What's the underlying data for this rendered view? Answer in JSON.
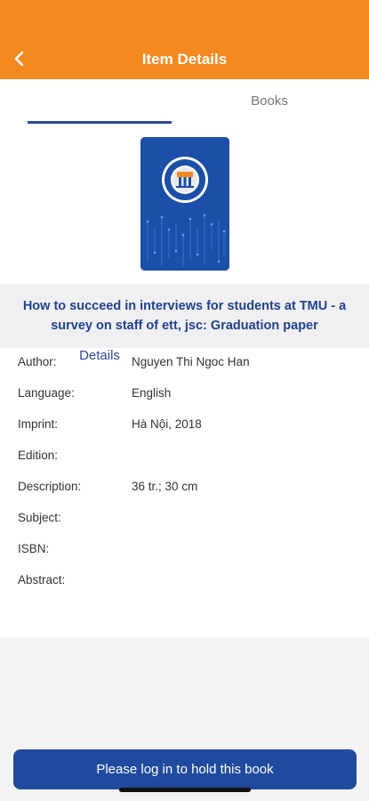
{
  "header": {
    "title": "Item Details",
    "back_icon": "chevron-left-icon"
  },
  "tabs": [
    {
      "label": "Details",
      "active": true
    },
    {
      "label": "Books",
      "active": false
    }
  ],
  "book": {
    "title": "How to succeed in interviews for students at TMU - a survey on staff of ett, jsc: Graduation paper"
  },
  "details": [
    {
      "label": "Author:",
      "value": "Nguyen Thi Ngoc Han"
    },
    {
      "label": "Language:",
      "value": "English"
    },
    {
      "label": "Imprint:",
      "value": "Hà Nội, 2018"
    },
    {
      "label": "Edition:",
      "value": ""
    },
    {
      "label": "Description:",
      "value": "36 tr.; 30 cm"
    },
    {
      "label": "Subject:",
      "value": ""
    },
    {
      "label": "ISBN:",
      "value": ""
    },
    {
      "label": "Abstract:",
      "value": ""
    }
  ],
  "actions": {
    "hold_label": "Please log in to hold this book"
  },
  "colors": {
    "header": "#f28a21",
    "accent": "#2d4a9a",
    "button": "#1f4a9e",
    "cover": "#1b4fa8"
  }
}
